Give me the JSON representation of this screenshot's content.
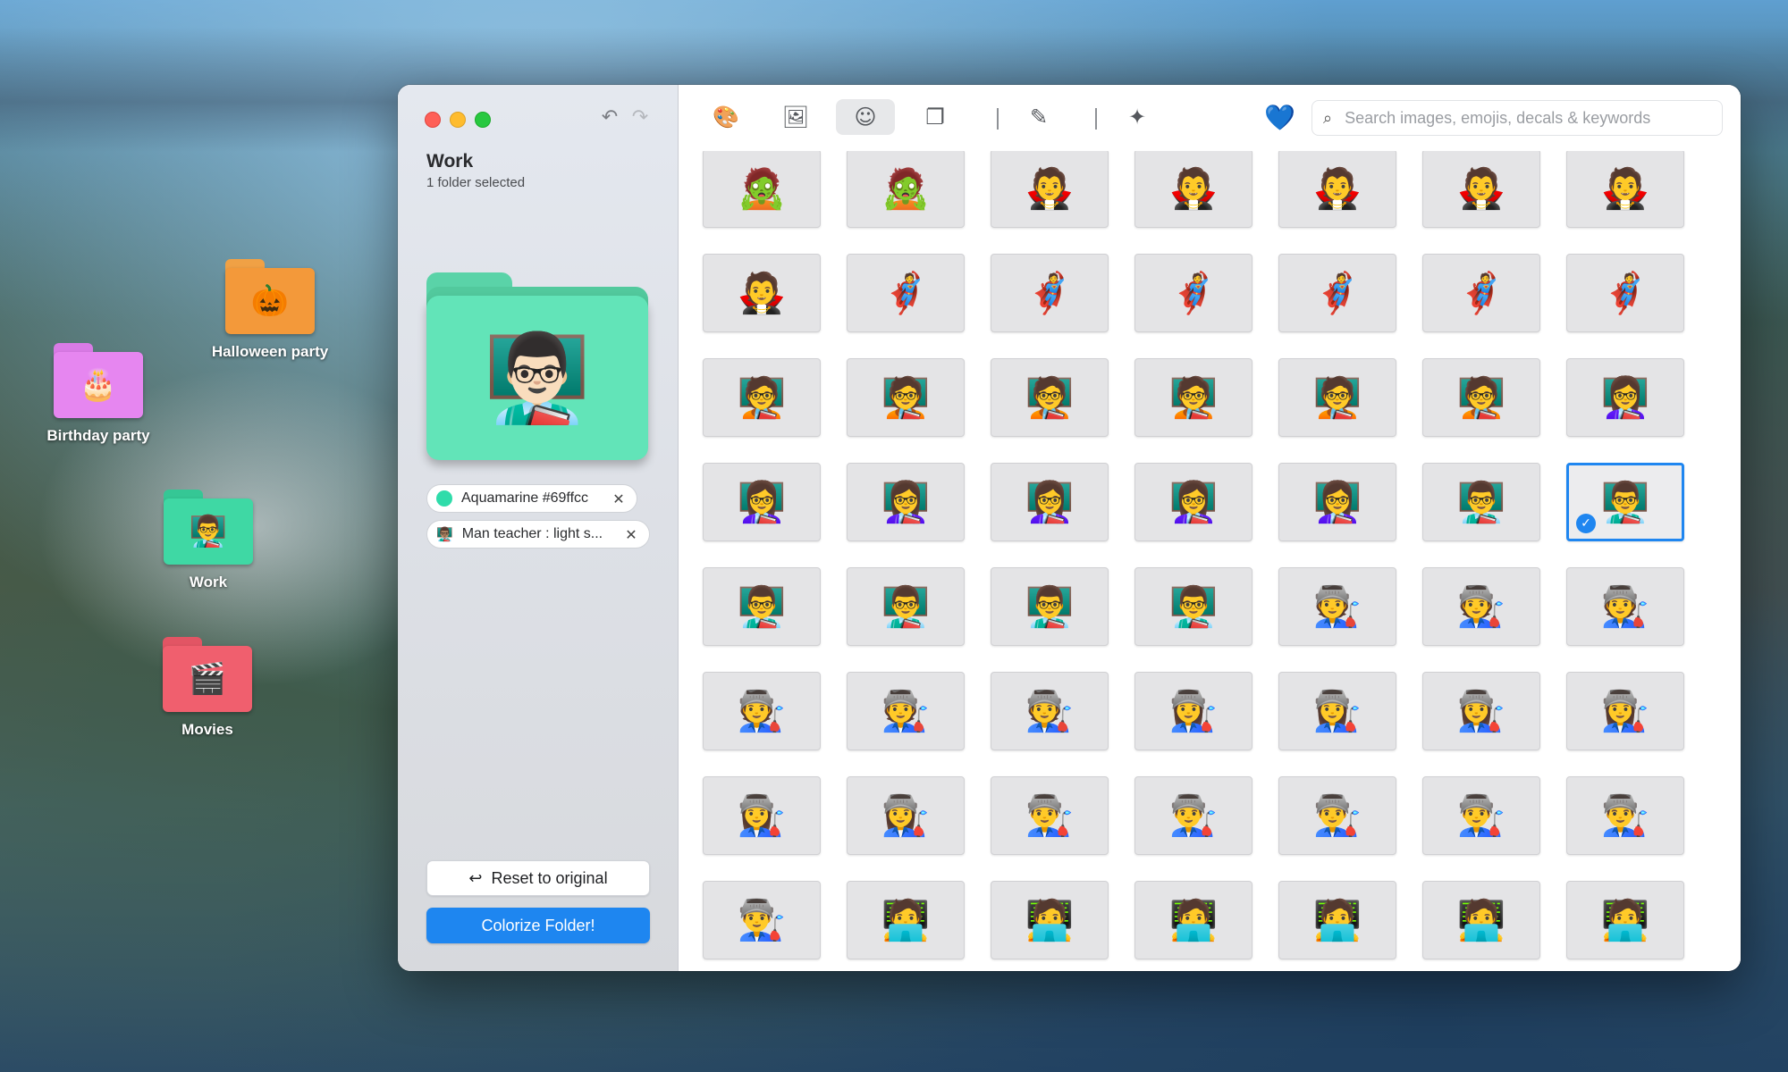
{
  "desktop": {
    "folders": [
      {
        "label": "Halloween party",
        "color": "#f3993a",
        "tab_color": "#f0a145",
        "icon": "jack-o-lantern-icon",
        "glyph": "🎃"
      },
      {
        "label": "Birthday party",
        "color": "#e686f0",
        "tab_color": "#da7be6",
        "icon": "birthday-cake-icon",
        "glyph": "🎂"
      },
      {
        "label": "Work",
        "color": "#3fd8a4",
        "tab_color": "#35c795",
        "icon": "man-teacher-icon",
        "glyph": "👨‍🏫"
      },
      {
        "label": "Movies",
        "color": "#f05f6e",
        "tab_color": "#e25564",
        "icon": "clapper-board-icon",
        "glyph": "🎬"
      }
    ]
  },
  "sidebar": {
    "folder_name": "Work",
    "selection_text": "1 folder selected",
    "preview_emoji": "👨🏻‍🏫",
    "color_chip": {
      "label": "Aquamarine #69ffcc",
      "swatch": "#2fdcaa"
    },
    "emoji_chip": {
      "label": "Man teacher : light s...",
      "glyph": "👨🏽‍🏫"
    },
    "reset_label": "Reset to original",
    "colorize_label": "Colorize Folder!",
    "undo_glyph": "↶",
    "redo_glyph": "↷"
  },
  "toolbar": {
    "tools": [
      {
        "name": "palette-tool",
        "glyph": "🎨",
        "active": false
      },
      {
        "name": "images-tool",
        "glyph": "🖼",
        "active": false
      },
      {
        "name": "emoji-tool",
        "glyph": "☺",
        "active": true
      },
      {
        "name": "shapes-tool",
        "glyph": "❐",
        "active": false
      },
      {
        "name": "eyedropper-tool",
        "glyph": "✎",
        "active": false
      },
      {
        "name": "sparkles-tool",
        "glyph": "✦",
        "active": false
      }
    ],
    "heart_glyph": "💙",
    "search_placeholder": "Search images, emojis, decals & keywords"
  },
  "grid": {
    "selected_index": 27,
    "emojis": [
      "🧟",
      "🧟",
      "🧛",
      "🧛",
      "🧛",
      "🧛",
      "🧛",
      "🧛",
      "🦸",
      "🦸",
      "🦸",
      "🦸",
      "🦸",
      "🦸",
      "🧑‍🏫",
      "🧑‍🏫",
      "🧑‍🏫",
      "🧑‍🏫",
      "🧑‍🏫",
      "🧑‍🏫",
      "👩‍🏫",
      "👩‍🏫",
      "👩‍🏫",
      "👩‍🏫",
      "👩‍🏫",
      "👩‍🏫",
      "👨‍🏫",
      "👨‍🏫",
      "👨‍🏫",
      "👨‍🏫",
      "👨‍🏫",
      "👨‍🏫",
      "🧑‍🏭",
      "🧑‍🏭",
      "🧑‍🏭",
      "🧑‍🏭",
      "🧑‍🏭",
      "🧑‍🏭",
      "👩‍🏭",
      "👩‍🏭",
      "👩‍🏭",
      "👩‍🏭",
      "👩‍🏭",
      "👩‍🏭",
      "👨‍🏭",
      "👨‍🏭",
      "👨‍🏭",
      "👨‍🏭",
      "👨‍🏭",
      "👨‍🏭",
      "🧑‍💻",
      "🧑‍💻",
      "🧑‍💻",
      "🧑‍💻",
      "🧑‍💻",
      "🧑‍💻"
    ]
  }
}
